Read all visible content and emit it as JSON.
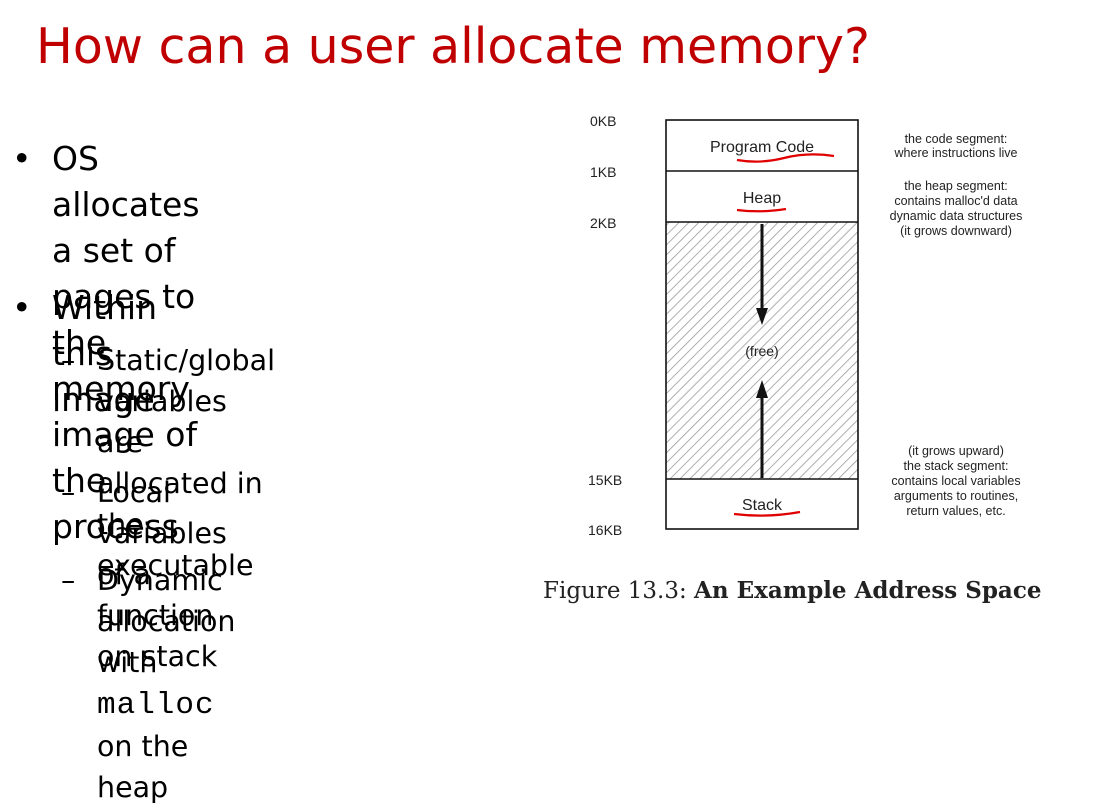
{
  "slide": {
    "title": "How can a user allocate memory?",
    "colors": {
      "title": "#c00000",
      "underline": "#e00000",
      "hatch": "#9a9a9a"
    },
    "bullets": [
      {
        "text": "OS allocates a set of pages to the memory image of the process",
        "lines": [
          "OS allocates a set of",
          "pages to the memory",
          "image of the process"
        ]
      },
      {
        "text": "Within this image",
        "lines": [
          "Within this image"
        ],
        "sub": [
          {
            "lines": [
              "Static/global variables",
              "are allocated in the",
              "executable"
            ]
          },
          {
            "lines": [
              "Local variables of a",
              "function on stack"
            ]
          },
          {
            "lines": [
              "Dynamic allocation with"
            ],
            "code": "malloc",
            "rest": " on the heap"
          }
        ]
      }
    ]
  },
  "figure": {
    "caption_prefix": "Figure 13.3: ",
    "caption_title": "An Example Address Space",
    "address_labels": [
      "0KB",
      "1KB",
      "2KB",
      "15KB",
      "16KB"
    ],
    "segments": [
      {
        "name": "Program Code",
        "annotation": [
          "the code segment:",
          "where instructions live"
        ]
      },
      {
        "name": "Heap",
        "annotation": [
          "the heap segment:",
          "contains malloc'd data",
          "dynamic data structures",
          "(it grows downward)"
        ]
      },
      {
        "name": "(free)"
      },
      {
        "name": "Stack",
        "annotation": [
          "(it grows upward)",
          "the stack segment:",
          "contains local variables",
          "arguments to routines,",
          "return values, etc."
        ]
      }
    ]
  }
}
